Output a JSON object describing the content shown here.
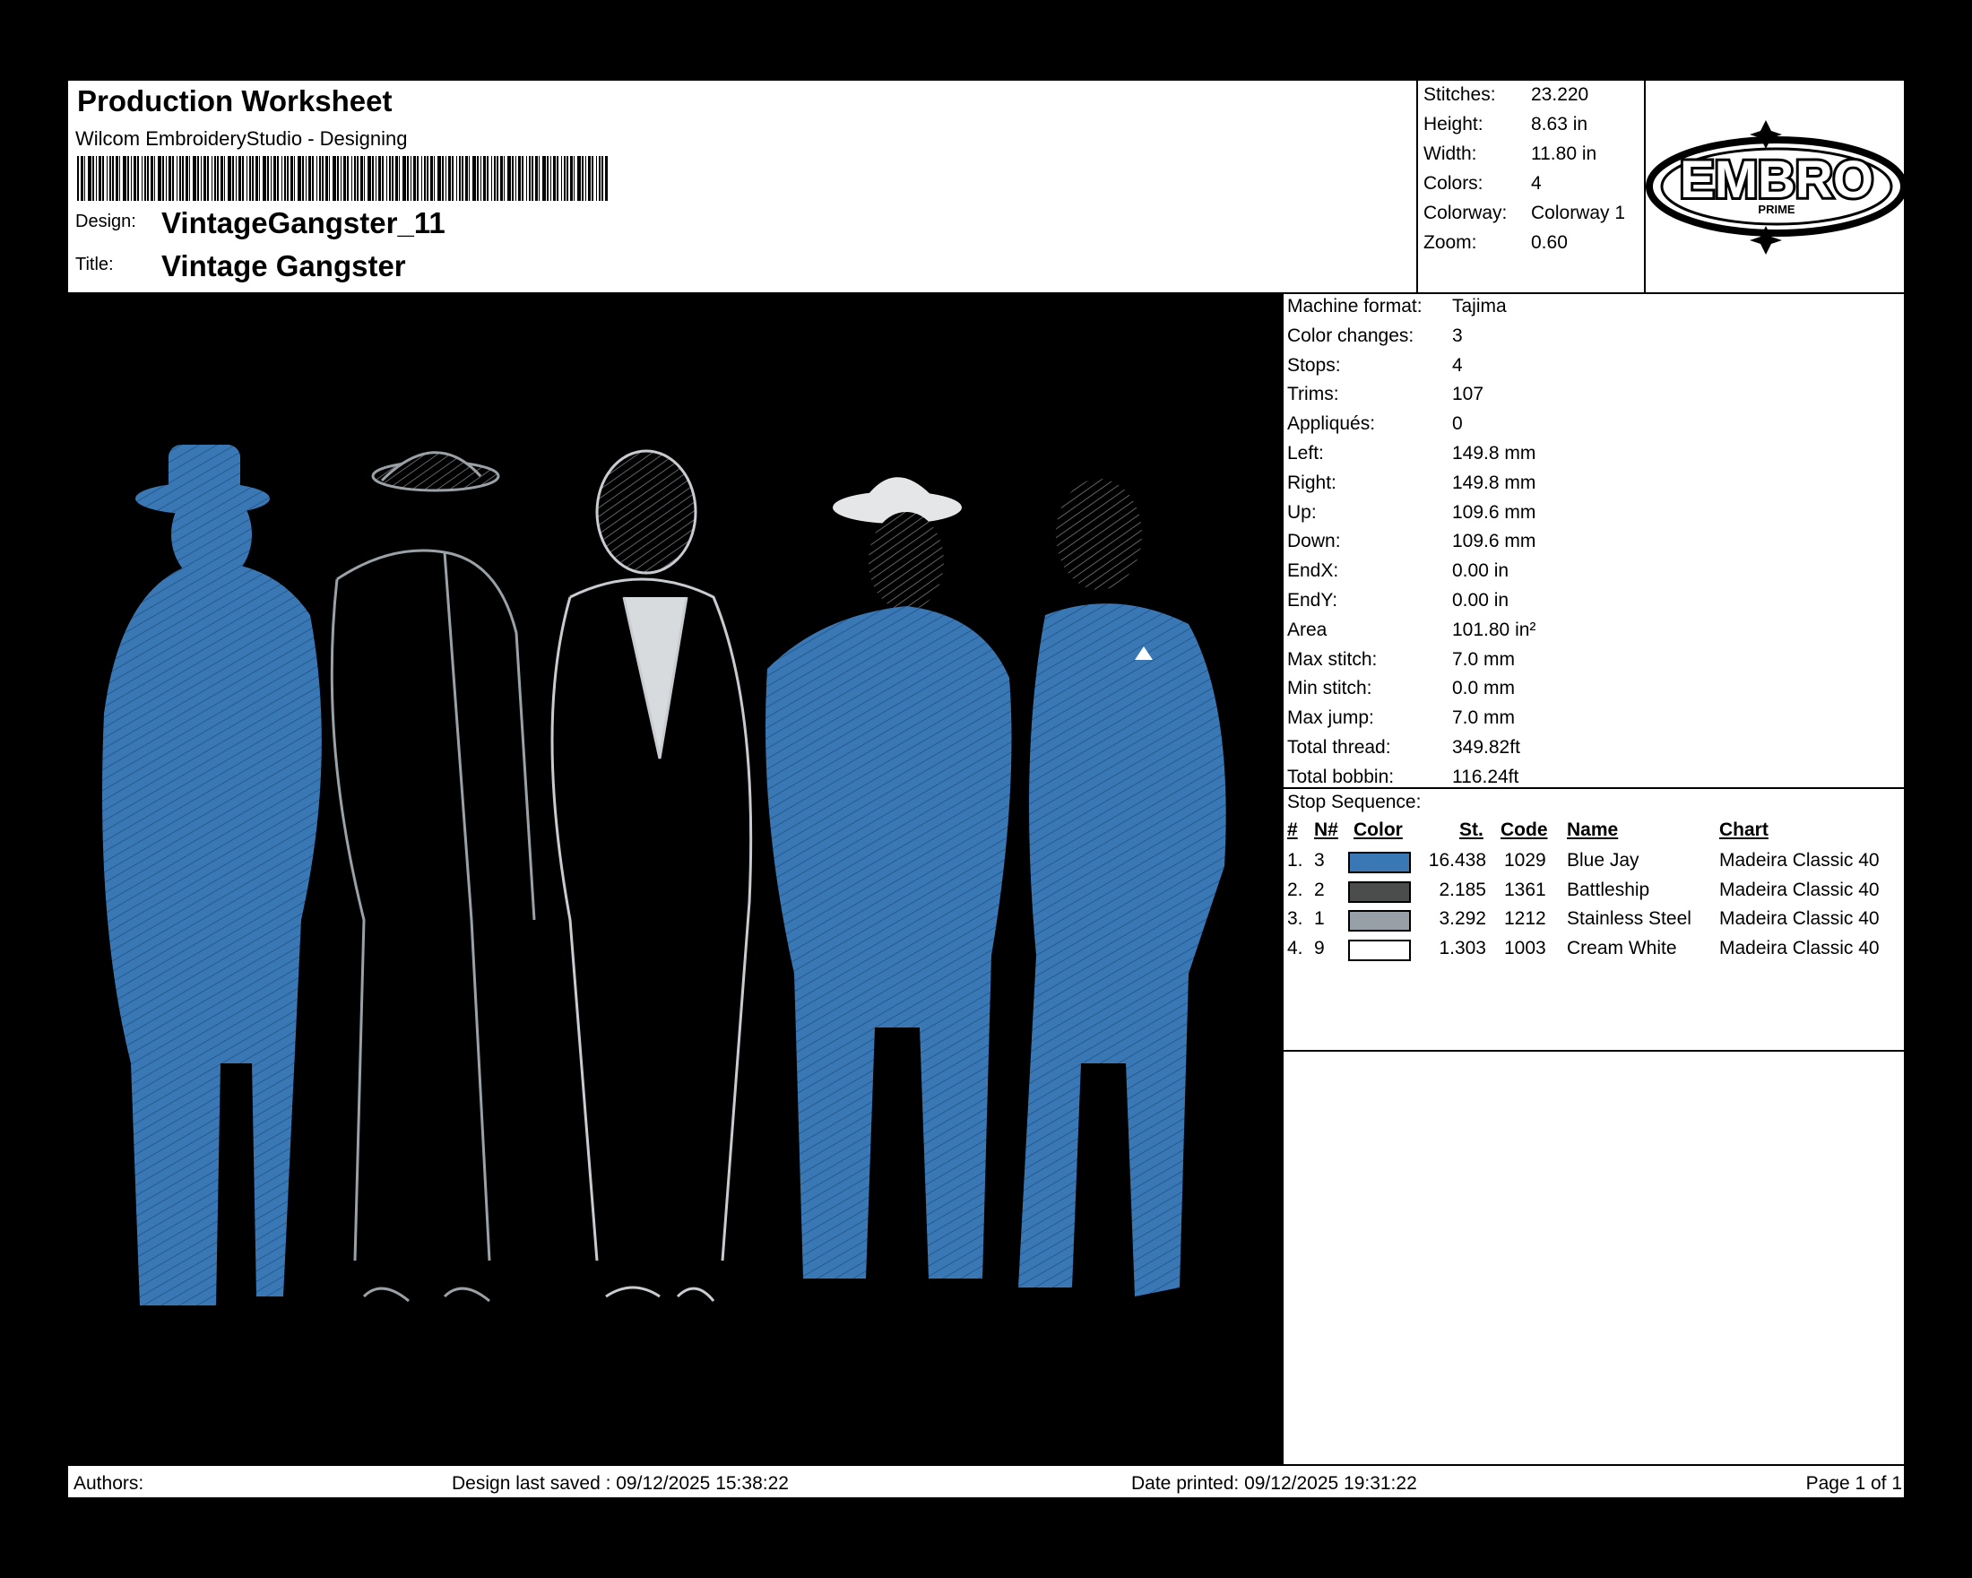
{
  "header": {
    "title": "Production Worksheet",
    "subtitle": "Wilcom EmbroideryStudio - Designing",
    "design_label": "Design:",
    "design_value": "VintageGangster_11",
    "title_label": "Title:",
    "title_value": "Vintage Gangster"
  },
  "stats": [
    {
      "label": "Stitches:",
      "value": "23.220"
    },
    {
      "label": "Height:",
      "value": "8.63 in"
    },
    {
      "label": "Width:",
      "value": "11.80 in"
    },
    {
      "label": "Colors:",
      "value": "4"
    },
    {
      "label": "Colorway:",
      "value": "Colorway 1"
    },
    {
      "label": "Zoom:",
      "value": "0.60"
    }
  ],
  "logo": {
    "text": "EMBRO",
    "subtext": "PRIME"
  },
  "details": [
    {
      "label": "Machine format:",
      "value": "Tajima"
    },
    {
      "label": "Color changes:",
      "value": "3"
    },
    {
      "label": "Stops:",
      "value": "4"
    },
    {
      "label": "Trims:",
      "value": "107"
    },
    {
      "label": "Appliqués:",
      "value": "0"
    },
    {
      "label": "Left:",
      "value": "149.8 mm"
    },
    {
      "label": "Right:",
      "value": "149.8 mm"
    },
    {
      "label": "Up:",
      "value": "109.6 mm"
    },
    {
      "label": "Down:",
      "value": "109.6 mm"
    },
    {
      "label": "EndX:",
      "value": "0.00 in"
    },
    {
      "label": "EndY:",
      "value": "0.00 in"
    },
    {
      "label": "Area",
      "value": "101.80 in²"
    },
    {
      "label": "Max stitch:",
      "value": "7.0 mm"
    },
    {
      "label": "Min stitch:",
      "value": "0.0 mm"
    },
    {
      "label": "Max jump:",
      "value": "7.0 mm"
    },
    {
      "label": "Total thread:",
      "value": "349.82ft"
    },
    {
      "label": "Total bobbin:",
      "value": "116.24ft"
    }
  ],
  "stop_sequence": {
    "title": "Stop Sequence:",
    "columns": [
      "#",
      "N#",
      "Color",
      "St.",
      "Code",
      "Name",
      "Chart"
    ],
    "rows": [
      {
        "idx": "1.",
        "n": "3",
        "color": "#3a78b5",
        "st": "16.438",
        "code": "1029",
        "name": "Blue Jay",
        "chart": "Madeira Classic 40"
      },
      {
        "idx": "2.",
        "n": "2",
        "color": "#4a4d4b",
        "st": "2.185",
        "code": "1361",
        "name": "Battleship",
        "chart": "Madeira Classic 40"
      },
      {
        "idx": "3.",
        "n": "1",
        "color": "#97a0a6",
        "st": "3.292",
        "code": "1212",
        "name": "Stainless Steel",
        "chart": "Madeira Classic 40"
      },
      {
        "idx": "4.",
        "n": "9",
        "color": "#ffffff",
        "st": "1.303",
        "code": "1003",
        "name": "Cream White",
        "chart": "Madeira Classic 40"
      }
    ]
  },
  "footer": {
    "authors": "Authors:",
    "saved": "Design last saved : 09/12/2025 15:38:22",
    "printed": "Date printed: 09/12/2025 19:31:22",
    "page": "Page 1 of 1"
  },
  "design_colors": {
    "blue": "#3a78b5",
    "grey": "#4a4d4b",
    "steel": "#97a0a6",
    "white": "#f0f0f0"
  }
}
